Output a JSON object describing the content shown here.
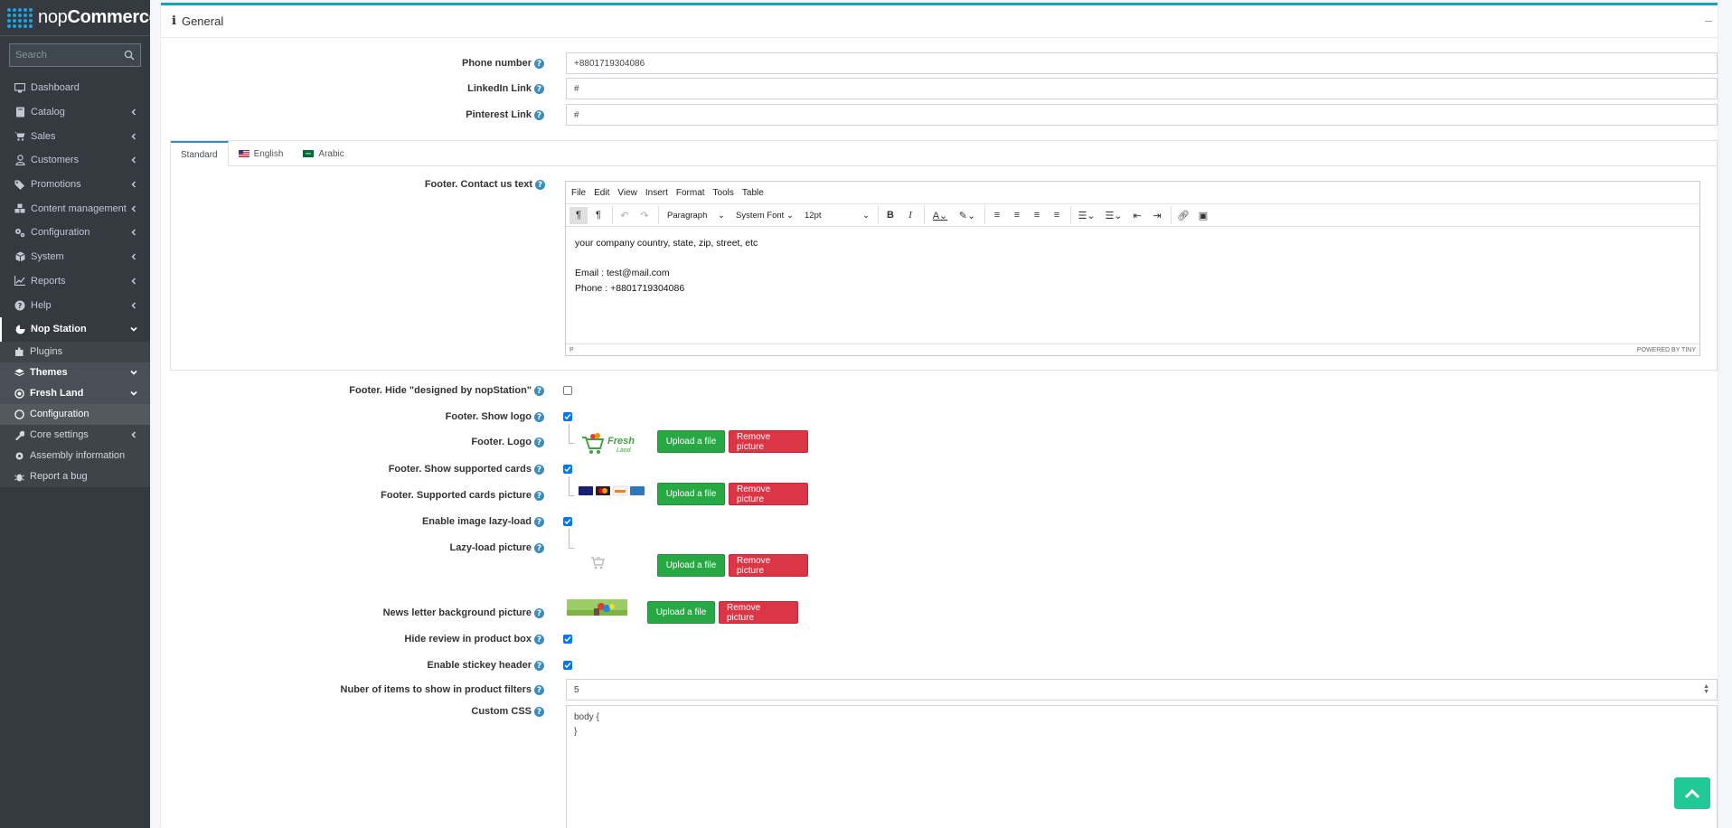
{
  "brand": {
    "name_light": "nop",
    "name_bold": "Commerce"
  },
  "sidebar": {
    "search_placeholder": "Search",
    "items": [
      {
        "label": "Dashboard",
        "icon": "monitor-icon",
        "chevron": false
      },
      {
        "label": "Catalog",
        "icon": "book-icon",
        "chevron": true
      },
      {
        "label": "Sales",
        "icon": "cart-icon",
        "chevron": true
      },
      {
        "label": "Customers",
        "icon": "user-icon",
        "chevron": true
      },
      {
        "label": "Promotions",
        "icon": "tags-icon",
        "chevron": true
      },
      {
        "label": "Content management",
        "icon": "cubes-icon",
        "chevron": true
      },
      {
        "label": "Configuration",
        "icon": "gears-icon",
        "chevron": true
      },
      {
        "label": "System",
        "icon": "cube-icon",
        "chevron": true
      },
      {
        "label": "Reports",
        "icon": "chart-icon",
        "chevron": true
      },
      {
        "label": "Help",
        "icon": "question-circle-icon",
        "chevron": true
      }
    ],
    "nop_station": {
      "label": "Nop Station"
    },
    "sub_items": {
      "plugins": "Plugins",
      "themes": "Themes",
      "fresh_land": "Fresh Land",
      "configuration": "Configuration",
      "core_settings": "Core settings",
      "assembly": "Assembly information",
      "report_bug": "Report a bug"
    }
  },
  "panel": {
    "title": "General",
    "collapse": "–"
  },
  "fields": {
    "phone": {
      "label": "Phone number",
      "value": "+8801719304086"
    },
    "linkedin": {
      "label": "LinkedIn Link",
      "value": "#"
    },
    "pinterest": {
      "label": "Pinterest Link",
      "value": "#"
    }
  },
  "tabs": [
    "Standard",
    "English",
    "Arabic"
  ],
  "footer_contact": {
    "label": "Footer. Contact us text",
    "menu": [
      "File",
      "Edit",
      "View",
      "Insert",
      "Format",
      "Tools",
      "Table"
    ],
    "block_format": "Paragraph",
    "font_family": "System Font",
    "font_size": "12pt",
    "content": [
      "your company country, state, zip, street, etc",
      "",
      "Email : test@mail.com",
      "Phone : +8801719304086"
    ],
    "status_path": "P",
    "powered": "POWERED BY TINY"
  },
  "settings": {
    "hide_designed": {
      "label": "Footer. Hide \"designed by nopStation\"",
      "checked": false
    },
    "show_logo": {
      "label": "Footer. Show logo",
      "checked": true
    },
    "logo": {
      "label": "Footer. Logo",
      "logo_text": "Fresh",
      "logo_sub": "Land"
    },
    "show_cards": {
      "label": "Footer. Show supported cards",
      "checked": true
    },
    "cards_picture": {
      "label": "Footer. Supported cards picture"
    },
    "lazy_load": {
      "label": "Enable image lazy-load",
      "checked": true
    },
    "lazy_picture": {
      "label": "Lazy-load picture"
    },
    "newsletter": {
      "label": "News letter background picture"
    },
    "hide_review": {
      "label": "Hide review in product box",
      "checked": true
    },
    "sticky_header": {
      "label": "Enable stickey header",
      "checked": true
    },
    "filter_items": {
      "label": "Nuber of items to show in product filters",
      "value": "5"
    },
    "custom_css": {
      "label": "Custom CSS",
      "value_line1": "body {",
      "value_line2": "}"
    }
  },
  "buttons": {
    "upload": "Upload a file",
    "remove": "Remove picture"
  },
  "help_glyph": "?",
  "colors": {
    "accent": "#17a2b8",
    "green": "#28a745",
    "red": "#dc3545",
    "sidebar": "#343a40",
    "scrolltop": "#20c997"
  }
}
